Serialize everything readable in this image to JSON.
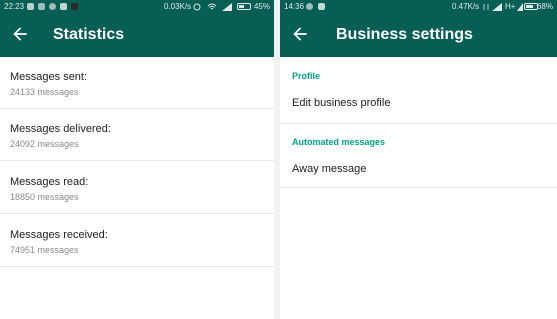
{
  "left": {
    "status": {
      "time": "22:23",
      "rate": "0.03K/s",
      "battery": "45%",
      "battery_level": 0.45
    },
    "appbar": {
      "title": "Statistics"
    },
    "stats": [
      {
        "label": "Messages sent:",
        "value": "24133 messages"
      },
      {
        "label": "Messages delivered:",
        "value": "24092 messages"
      },
      {
        "label": "Messages read:",
        "value": "18850 messages"
      },
      {
        "label": "Messages received:",
        "value": "74951 messages"
      }
    ]
  },
  "right": {
    "status": {
      "time": "14:36",
      "rate": "0.47K/s",
      "network": "H+",
      "battery": "68%",
      "battery_level": 0.68
    },
    "appbar": {
      "title": "Business settings"
    },
    "sections": [
      {
        "header": "Profile",
        "items": [
          "Edit business profile"
        ]
      },
      {
        "header": "Automated messages",
        "items": [
          "Away message"
        ]
      }
    ]
  },
  "colors": {
    "header": "#075e54",
    "accent": "#00a884",
    "status_text": "#dfe9e7"
  },
  "icons": [
    "back-arrow-icon",
    "wifi-icon",
    "signal-icon",
    "battery-icon",
    "sync-icon"
  ]
}
